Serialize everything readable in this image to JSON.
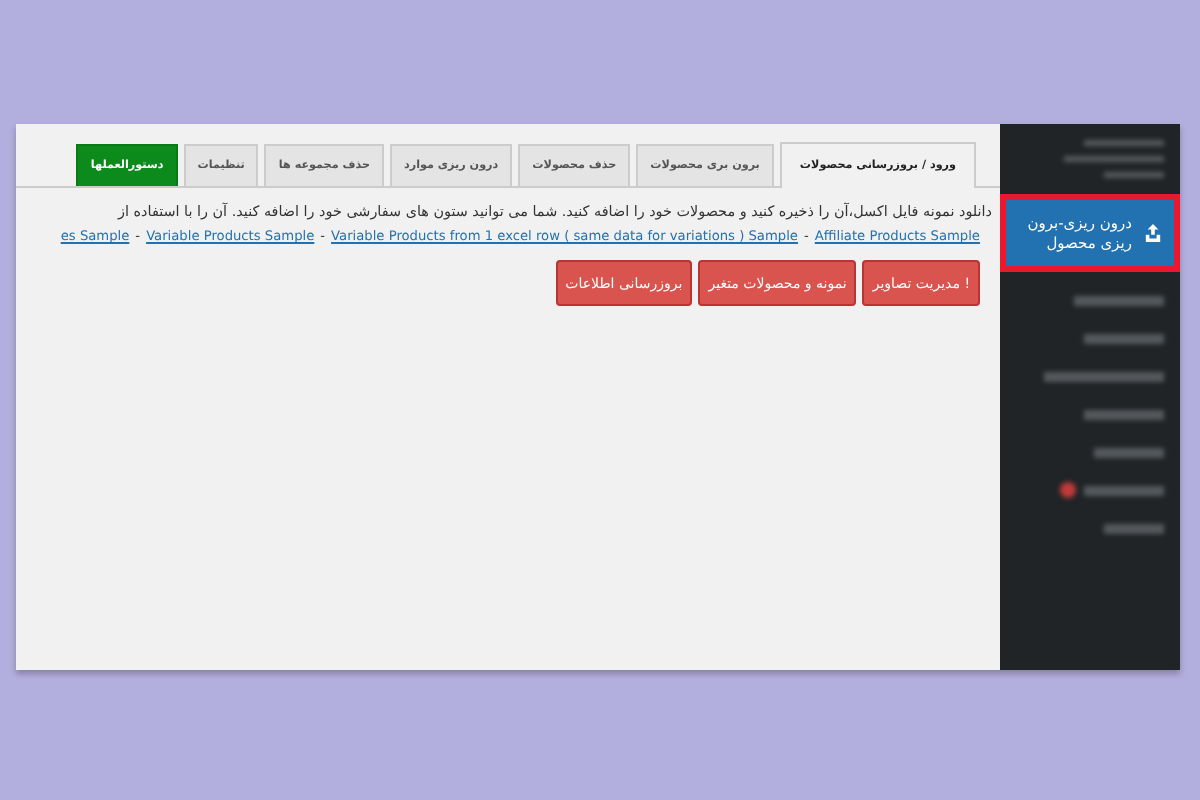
{
  "tabs": [
    {
      "label": "ورود / بروزرسانی محصولات",
      "selected": true,
      "kind": "tab"
    },
    {
      "label": "برون بری محصولات",
      "selected": false,
      "kind": "tab"
    },
    {
      "label": "حذف محصولات",
      "selected": false,
      "kind": "tab"
    },
    {
      "label": "درون ریزی موارد",
      "selected": false,
      "kind": "tab"
    },
    {
      "label": "حذف مجموعه ها",
      "selected": false,
      "kind": "tab"
    },
    {
      "label": "تنظیمات",
      "selected": false,
      "kind": "tab"
    },
    {
      "label": "دستورالعملها",
      "selected": false,
      "kind": "guide"
    }
  ],
  "description": "دانلود نمونه فایل اکسل،آن را ذخیره کنید و محصولات خود را اضافه کنید. شما می توانید ستون های سفارشی خود را اضافه کنید. آن را با استفاده از",
  "sample_links": [
    "Affiliate Products Sample",
    "Variable Products from 1 excel row ( same data for variations ) Sample",
    "Variable Products Sample",
    "es Sample"
  ],
  "link_separator": "-",
  "buttons": [
    "! مدیریت تصاویر",
    "نمونه و محصولات متغیر",
    "بروزرسانی اطلاعات"
  ],
  "sidebar": {
    "highlighted_item": {
      "label": "درون ریزی-برون ریزی محصول",
      "selected": true
    }
  }
}
